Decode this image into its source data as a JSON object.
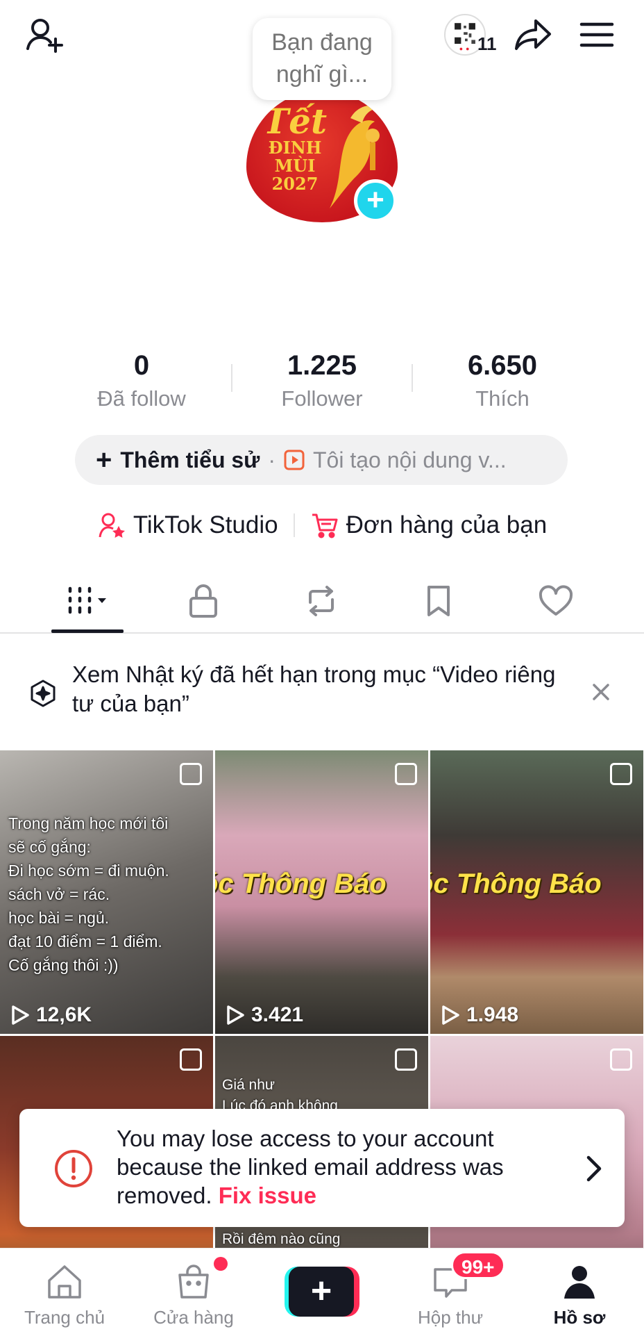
{
  "header": {
    "qr_count": "11",
    "thought_bubble_line1": "Bạn đang",
    "thought_bubble_line2": "nghĩ gì..."
  },
  "avatar": {
    "title": "Tết",
    "line1": "ĐINH",
    "line2": "MÙI",
    "line3": "2027"
  },
  "stats": [
    {
      "value": "0",
      "label": "Đã follow"
    },
    {
      "value": "1.225",
      "label": "Follower"
    },
    {
      "value": "6.650",
      "label": "Thích"
    }
  ],
  "bio": {
    "plus": "+",
    "add_label": "Thêm tiểu sử",
    "separator": "·",
    "placeholder": "Tôi tạo nội dung v..."
  },
  "links": {
    "studio": "TikTok Studio",
    "orders": "Đơn hàng của bạn"
  },
  "banner": {
    "text": "Xem Nhật ký đã hết hạn trong mục “Video riêng tư của bạn”"
  },
  "videos": [
    {
      "views": "12,6K",
      "caption": [
        "Trong năm học mới tôi",
        "sẽ cố gắng:",
        "Đi học sớm = đi muộn.",
        "sách vở = rác.",
        "học bài = ngủ.",
        "đạt 10 điểm = 1 điểm.",
        "Cố gắng thôi :))"
      ]
    },
    {
      "views": "3.421",
      "overlay": "óc Thông Báo"
    },
    {
      "views": "1.948",
      "overlay": "óc Thông Báo"
    },
    {
      "views": ""
    },
    {
      "views": "",
      "caption_top": [
        "Giá như",
        "Lúc đó anh không"
      ],
      "caption_bottom": "Rồi đêm nào cũng"
    },
    {
      "views": ""
    }
  ],
  "warning": {
    "message": "You may lose access to your account because the linked email address was removed.",
    "fix_label": "Fix issue"
  },
  "bottom_nav": {
    "home": "Trang chủ",
    "shop": "Cửa hàng",
    "create": "+",
    "inbox": "Hộp thư",
    "inbox_badge": "99+",
    "profile": "Hồ sơ"
  },
  "colors": {
    "accent": "#fe2c55",
    "cyan": "#25f4ee",
    "text": "#161823",
    "muted": "#8a8b91"
  }
}
